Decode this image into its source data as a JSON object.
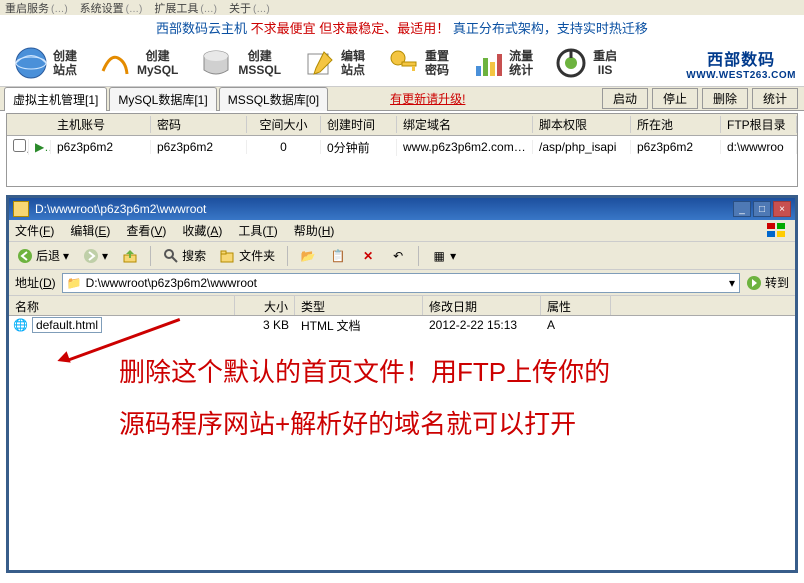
{
  "top_menu": {
    "item1": "重启服务",
    "item2": "系统设置",
    "item3": "扩展工具",
    "item4": "关于"
  },
  "banner": {
    "t1": "西部数码云主机 ",
    "t2": "不求最便宜 但求最稳定、最适用！",
    "t3": "真正分布式架构，支持实时热迁移"
  },
  "toolbar": {
    "b1": {
      "l1": "创建",
      "l2": "站点"
    },
    "b2": {
      "l1": "创建",
      "l2": "MySQL"
    },
    "b3": {
      "l1": "创建",
      "l2": "MSSQL"
    },
    "b4": {
      "l1": "编辑",
      "l2": "站点"
    },
    "b5": {
      "l1": "重置",
      "l2": "密码"
    },
    "b6": {
      "l1": "流量",
      "l2": "统计"
    },
    "b7": {
      "l1": "重启",
      "l2": "IIS"
    },
    "logo": {
      "main": "西部数码",
      "sub": "WWW.WEST263.COM"
    }
  },
  "tabs": {
    "t1": "虚拟主机管理[1]",
    "t2": "MySQL数据库[1]",
    "t3": "MSSQL数据库[0]",
    "upgrade": "有更新请升级!",
    "btn1": "启动",
    "btn2": "停止",
    "btn3": "删除",
    "btn4": "统计"
  },
  "grid": {
    "head": {
      "c2": "主机账号",
      "c3": "密码",
      "c4": "空间大小",
      "c5": "创建时间",
      "c6": "绑定域名",
      "c7": "脚本权限",
      "c8": "所在池",
      "c9": "FTP根目录"
    },
    "row": {
      "c2": "p6z3p6m2",
      "c3": "p6z3p6m2",
      "c4": "0",
      "c5": "0分钟前",
      "c6": "www.p6z3p6m2.com,p6...",
      "c7": "/asp/php_isapi",
      "c8": "p6z3p6m2",
      "c9": "d:\\wwwroo"
    }
  },
  "explorer": {
    "title": "D:\\wwwroot\\p6z3p6m2\\wwwroot",
    "menu": {
      "m1_pre": "文件(",
      "m1_u": "F",
      "m1_post": ")",
      "m2_pre": "编辑(",
      "m2_u": "E",
      "m2_post": ")",
      "m3_pre": "查看(",
      "m3_u": "V",
      "m3_post": ")",
      "m4_pre": "收藏(",
      "m4_u": "A",
      "m4_post": ")",
      "m5_pre": "工具(",
      "m5_u": "T",
      "m5_post": ")",
      "m6_pre": "帮助(",
      "m6_u": "H",
      "m6_post": ")"
    },
    "tools": {
      "back": "后退",
      "search": "搜索",
      "folders": "文件夹"
    },
    "addr": {
      "label_pre": "地址(",
      "label_u": "D",
      "label_post": ")",
      "value": "D:\\wwwroot\\p6z3p6m2\\wwwroot",
      "go": "转到"
    },
    "cols": {
      "c0": "名称",
      "c1": "大小",
      "c2": "类型",
      "c3": "修改日期",
      "c4": "属性"
    },
    "file": {
      "name": "default.html",
      "size": "3 KB",
      "type": "HTML 文档",
      "date": "2012-2-22 15:13",
      "attr": "A"
    },
    "annotation": {
      "line1": "删除这个默认的首页文件！用FTP上传你的",
      "line2": "源码程序网站+解析好的域名就可以打开"
    }
  }
}
